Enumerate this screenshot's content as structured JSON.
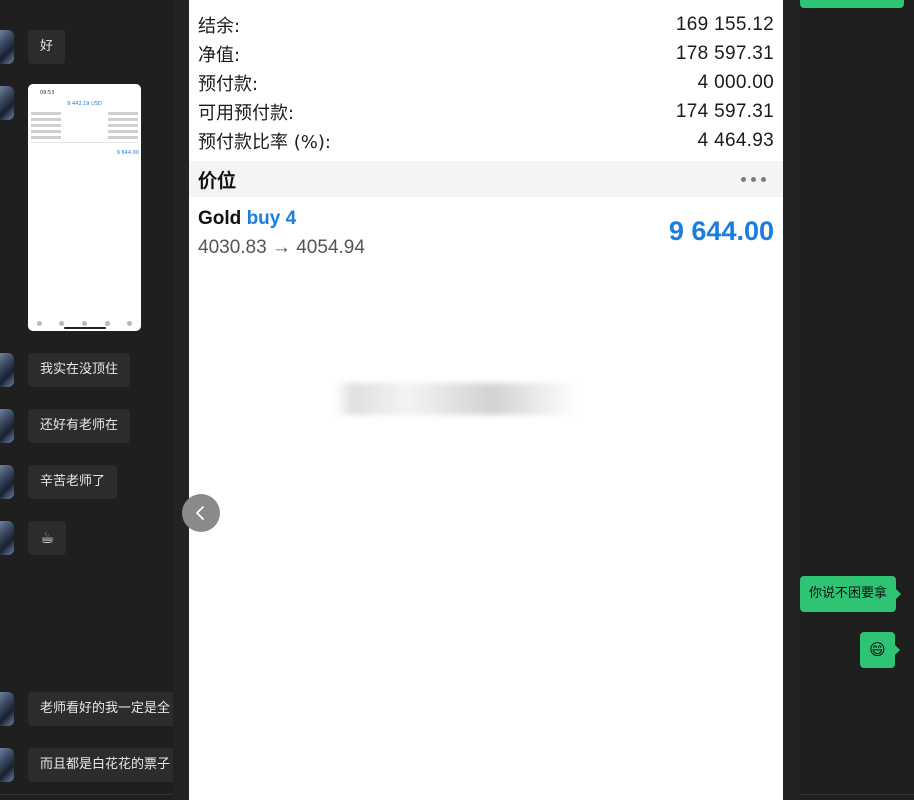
{
  "chat_left": {
    "messages": [
      {
        "text": "好"
      },
      {
        "text": "我实在没顶住"
      },
      {
        "text": "还好有老师在"
      },
      {
        "text": "辛苦老师了"
      },
      {
        "text": "☕"
      },
      {
        "text": "老师看好的我一定是全"
      },
      {
        "text": "而且都是白花花的票子"
      }
    ],
    "thumbnail": {
      "time": "09:53",
      "title": "9 442.19 USD",
      "price": "9 644.00"
    }
  },
  "viewer": {
    "account": [
      {
        "label": "结余:",
        "value": "169 155.12"
      },
      {
        "label": "净值:",
        "value": "178 597.31"
      },
      {
        "label": "预付款:",
        "value": "4 000.00"
      },
      {
        "label": "可用预付款:",
        "value": "174 597.31"
      },
      {
        "label": "预付款比率 (%):",
        "value": "4 464.93"
      }
    ],
    "section_title": "价位",
    "position": {
      "symbol": "Gold",
      "side": "buy 4",
      "prices": "4030.83 → 4054.94",
      "profit": "9 644.00"
    },
    "colors": {
      "accent": "#1a7de0"
    }
  },
  "chat_right": {
    "messages": [
      {
        "text": "你说不困要拿"
      },
      {
        "text": "😄"
      }
    ],
    "colors": {
      "bubble": "#2fc374"
    }
  },
  "icons": {
    "nav_back": "chevron-left-icon",
    "more": "more-horizontal-icon"
  }
}
